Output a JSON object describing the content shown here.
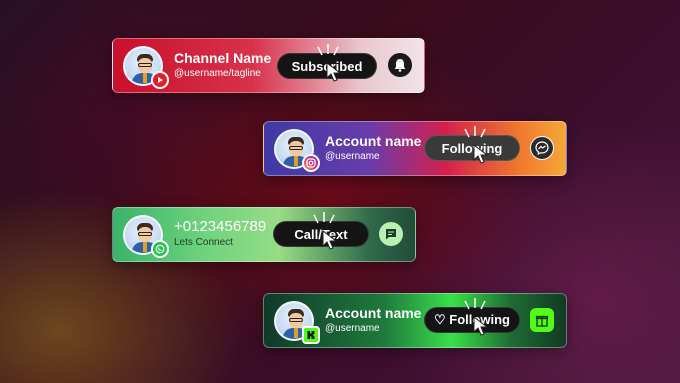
{
  "cards": [
    {
      "platform_icon": "youtube-icon",
      "name": "Channel Name",
      "subtitle": "@username/tagline",
      "button_label": "Subscribed",
      "action_icon": "bell-icon"
    },
    {
      "platform_icon": "instagram-icon",
      "name": "Account name",
      "subtitle": "@username",
      "button_label": "Following",
      "action_icon": "messenger-icon"
    },
    {
      "platform_icon": "whatsapp-icon",
      "name": "+0123456789",
      "subtitle": "Lets Connect",
      "button_label": "Call/Text",
      "action_icon": "chat-icon"
    },
    {
      "platform_icon": "kick-icon",
      "name": "Account name",
      "subtitle": "@username",
      "button_label": "♡ Following",
      "action_icon": "gift-icon"
    }
  ],
  "colors": {
    "youtube": "#e21f26",
    "whatsapp": "#27c24c",
    "kick": "#53fc18"
  }
}
